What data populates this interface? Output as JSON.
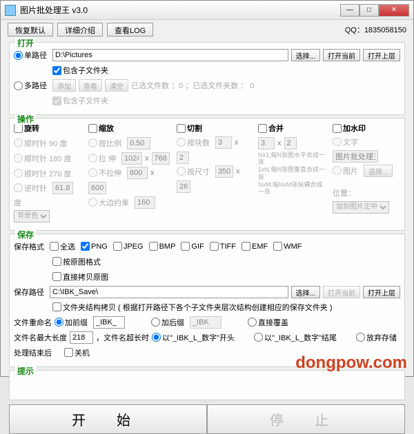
{
  "window": {
    "title": "图片批处理王 v3.0"
  },
  "toolbar": {
    "restore": "恢复默认",
    "detail": "详细介绍",
    "viewlog": "查看LOG",
    "qq": "QQ：1835058150"
  },
  "open": {
    "title": "打开",
    "single": "单路径",
    "multi": "多路径",
    "path": "D:\\Pictures",
    "browse": "选择...",
    "openCur": "打开当前",
    "openUp": "打开上层",
    "incSub": "包含子文件夹",
    "add": "添加",
    "view": "查看",
    "clear": "清空",
    "status": "已选文件数  ：0  ；已选文件夹数 ：  0"
  },
  "ops": {
    "title": "操作",
    "rotate": "旋转",
    "scale": "缩放",
    "cut": "切割",
    "merge": "合并",
    "wm": "加水印",
    "cw90": "顺时针  90  度",
    "cw180": "顺时针 180 度",
    "cw270": "顺时针 270 度",
    "ccw": "逆时针",
    "ccwVal": "61.8",
    "deg": "度",
    "bgSel": "背景色",
    "byRatio": "按比例",
    "ratioVal": "0.50",
    "stretch": "拉   伸",
    "sw": "1024",
    "sh": "768",
    "noStretch": "不拉伸",
    "nw": "800",
    "nh": "600",
    "approx": "大边约束",
    "apx": "160",
    "byNum": "按块数",
    "bn1": "3",
    "bn2": "2",
    "bySize": "按尺寸",
    "bs1": "350",
    "bs2": "26",
    "m1": "3",
    "m2": "2",
    "mergeHint1": "Nx1,每N张图水平合成一张",
    "mergeHint2": "1xN,每N张图垂直合成一张",
    "mergeHint3": "NxM,每NxM张纵横合成一张",
    "wmText": "文字",
    "wmTextVal": "图片批处理王",
    "wmImg": "图片",
    "wmBrowse": "选择...",
    "pos": "位置：",
    "posSel": "加到图片正中"
  },
  "save": {
    "title": "保存",
    "fmt": "保存格式",
    "all": "全选",
    "png": "PNG",
    "jpeg": "JPEG",
    "bmp": "BMP",
    "gif": "GIF",
    "tiff": "TIFF",
    "emf": "EMF",
    "wmf": "WMF",
    "orig": "按原图格式",
    "direct": "直接拷贝原图",
    "pathLbl": "保存路径",
    "path": "C:\\IBK_Save\\",
    "browse": "选择...",
    "openCur": "打开当前",
    "openUp": "打开上层",
    "copyStruct": "文件夹结构拷贝 ( 根据打开路径下各个子文件夹层次结构创建相应的保存文件夹 )",
    "rename": "文件重命名",
    "prefix": "加前缀",
    "prefixVal": "_IBK_",
    "suffix": "加后缀",
    "suffixVal": "_IBK",
    "overwrite": "直接覆盖",
    "maxlen": "文件名最大长度",
    "maxlenVal": "218",
    "onExceed": "，文件名超长时",
    "startWith": "以\"_IBK_L_数字\"开头",
    "endWith": "以\"_IBK_L_数字\"结尾",
    "discard": "放弃存储",
    "after": "处理结束后",
    "shutdown": "关机"
  },
  "hint": {
    "title": "提示"
  },
  "start": {
    "start": "开  始",
    "stop": "停  止"
  },
  "watermark": "dongpow.com"
}
